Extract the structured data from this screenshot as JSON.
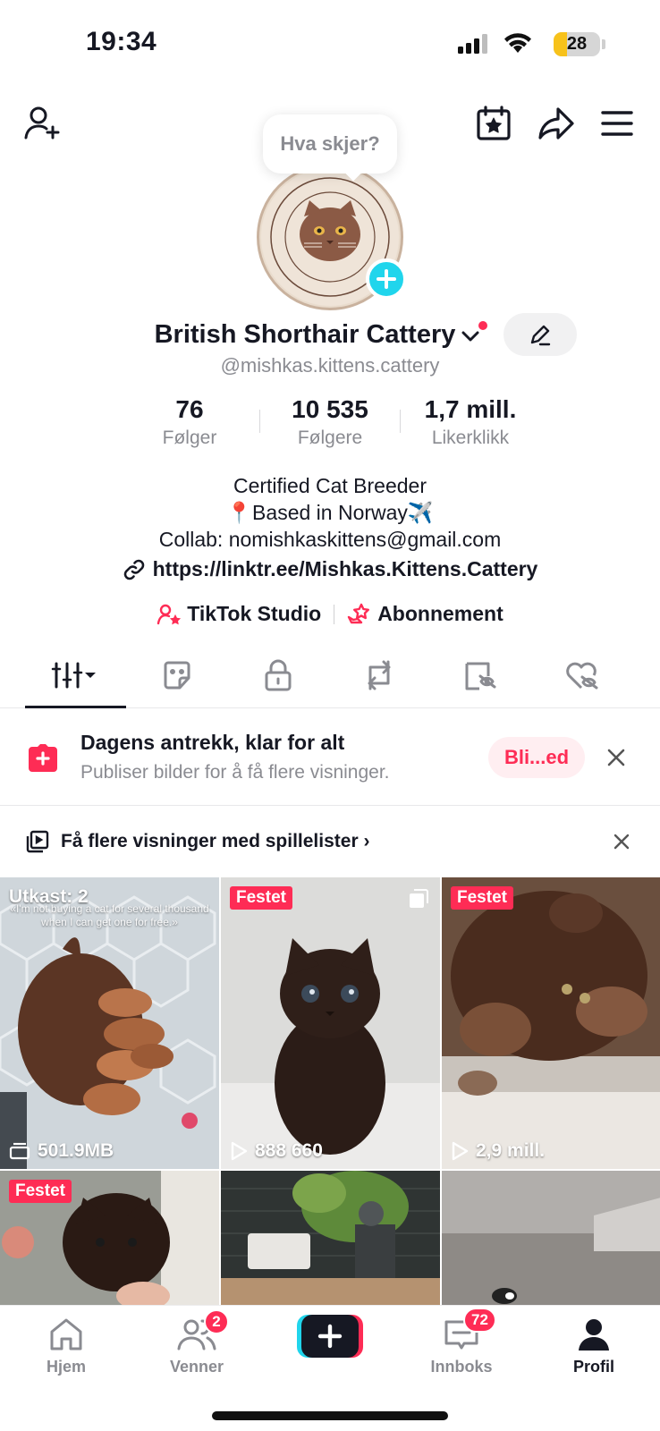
{
  "status_bar": {
    "time": "19:34",
    "battery_level": "28",
    "battery_fraction": 0.28,
    "battery_color": "#f7c21b"
  },
  "profile": {
    "bubble_text": "Hva skjer?",
    "name": "British Shorthair Cattery",
    "handle": "@mishkas.kittens.cattery",
    "stats": [
      {
        "value": "76",
        "label": "Følger"
      },
      {
        "value": "10 535",
        "label": "Følgere"
      },
      {
        "value": "1,7 mill.",
        "label": "Likerklikk"
      }
    ],
    "bio_lines": [
      "Certified Cat Breeder",
      "📍Based in Norway✈️",
      "Collab: nomishkaskittens@gmail.com"
    ],
    "link": "https://linktr.ee/Mishkas.Kittens.Cattery",
    "tools": {
      "studio": "TikTok Studio",
      "subscription": "Abonnement"
    }
  },
  "tabs": [
    "videos-grid-icon",
    "favorites-sticker-icon",
    "lock-icon",
    "repost-icon",
    "tagged-icon",
    "liked-heart-icon"
  ],
  "promo": {
    "title": "Dagens antrekk, klar for alt",
    "subtitle": "Publiser bilder for å få flere visninger.",
    "button": "Bli...ed"
  },
  "playlist_banner": {
    "text": "Få flere visninger med spillelister ›"
  },
  "grid": [
    {
      "title": "Utkast: 2",
      "caption": "«I'm not buying a cat for several thousand when I can get one for free.»",
      "meta": "501.9MB"
    },
    {
      "badge": "Festet",
      "meta": "888 660"
    },
    {
      "badge": "Festet",
      "meta": "2,9 mill."
    },
    {
      "badge": "Festet"
    },
    {},
    {}
  ],
  "bottom_nav": {
    "home": "Hjem",
    "friends": "Venner",
    "friends_badge": "2",
    "inbox": "Innboks",
    "inbox_badge": "72",
    "profile": "Profil"
  },
  "colors": {
    "accent": "#fe2c55",
    "cyan": "#20d5ec",
    "text": "#161823",
    "muted": "#8a8b91"
  }
}
